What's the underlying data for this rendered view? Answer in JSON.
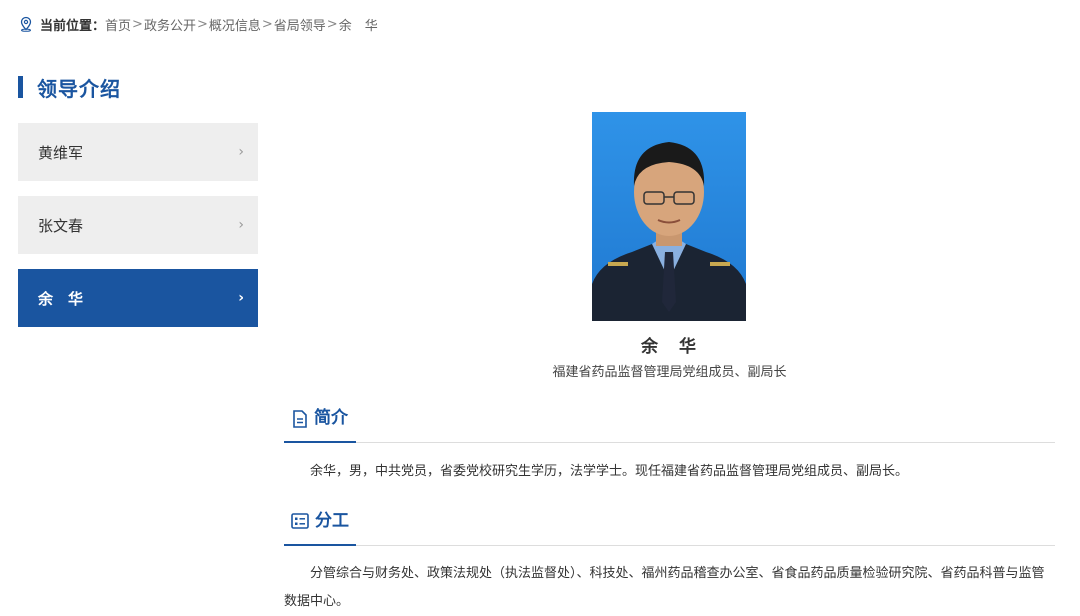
{
  "breadcrumb": {
    "prefix": "当前位置：",
    "items": [
      "首页",
      "政务公开",
      "概况信息",
      "省局领导",
      "余　华"
    ],
    "separator": ">"
  },
  "sidebar": {
    "title": "领导介绍",
    "items": [
      {
        "label": "黄维军",
        "active": false
      },
      {
        "label": "张文春",
        "active": false
      },
      {
        "label": "余　华",
        "active": true
      }
    ],
    "chevron": "›"
  },
  "profile": {
    "name": "余　华",
    "title": "福建省药品监督管理局党组成员、副局长"
  },
  "sections": {
    "intro": {
      "heading": "简介",
      "text": "余华，男，中共党员，省委党校研究生学历，法学学士。现任福建省药品监督管理局党组成员、副局长。"
    },
    "duties": {
      "heading": "分工",
      "text": "分管综合与财务处、政策法规处（执法监督处）、科技处、福州药品稽查办公室、省食品药品质量检验研究院、省药品科普与监管数据中心。"
    }
  },
  "colors": {
    "accent": "#1a55a0",
    "nav_bg": "#eeeeee",
    "photo_bg": "#2a8be0"
  }
}
